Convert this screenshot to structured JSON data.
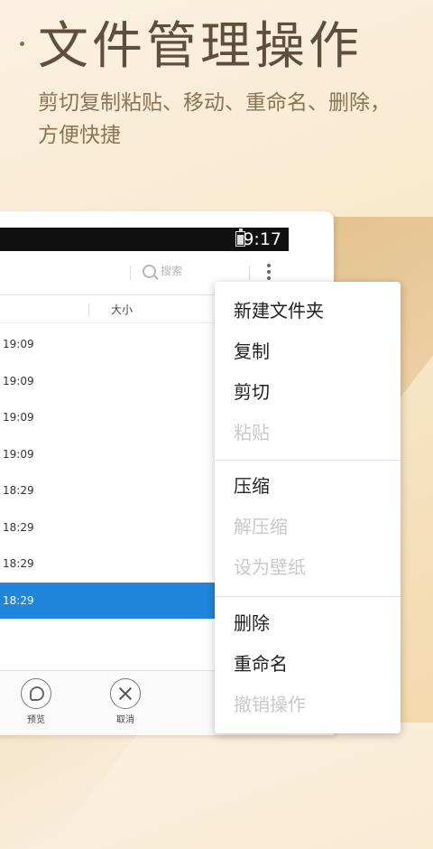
{
  "hero": {
    "title": "文件管理操作",
    "subtitle": "剪切复制粘贴、移动、重命名、删除，方便快捷"
  },
  "status_bar": {
    "time": "9:17"
  },
  "toolbar": {
    "search_placeholder": "搜索"
  },
  "column_header": {
    "size_label": "大小"
  },
  "rows": [
    {
      "time": "19:09",
      "selected": false
    },
    {
      "time": "19:09",
      "selected": false
    },
    {
      "time": "19:09",
      "selected": false
    },
    {
      "time": "19:09",
      "selected": false
    },
    {
      "time": "18:29",
      "selected": false
    },
    {
      "time": "18:29",
      "selected": false
    },
    {
      "time": "18:29",
      "selected": false
    },
    {
      "time": "18:29",
      "selected": true
    }
  ],
  "bottom_bar": {
    "preview_label": "预览",
    "cancel_label": "取消"
  },
  "context_menu": {
    "items": [
      {
        "label": "新建文件夹",
        "enabled": true
      },
      {
        "label": "复制",
        "enabled": true
      },
      {
        "label": "剪切",
        "enabled": true
      },
      {
        "label": "粘贴",
        "enabled": false
      },
      {
        "label": "压缩",
        "enabled": true
      },
      {
        "label": "解压缩",
        "enabled": false
      },
      {
        "label": "设为壁纸",
        "enabled": false
      },
      {
        "label": "删除",
        "enabled": true
      },
      {
        "label": "重命名",
        "enabled": true
      },
      {
        "label": "撤销操作",
        "enabled": false
      }
    ]
  },
  "colors": {
    "selection": "#1f86dc",
    "background": "#f8e6c8",
    "heading": "#5e4e3a"
  }
}
